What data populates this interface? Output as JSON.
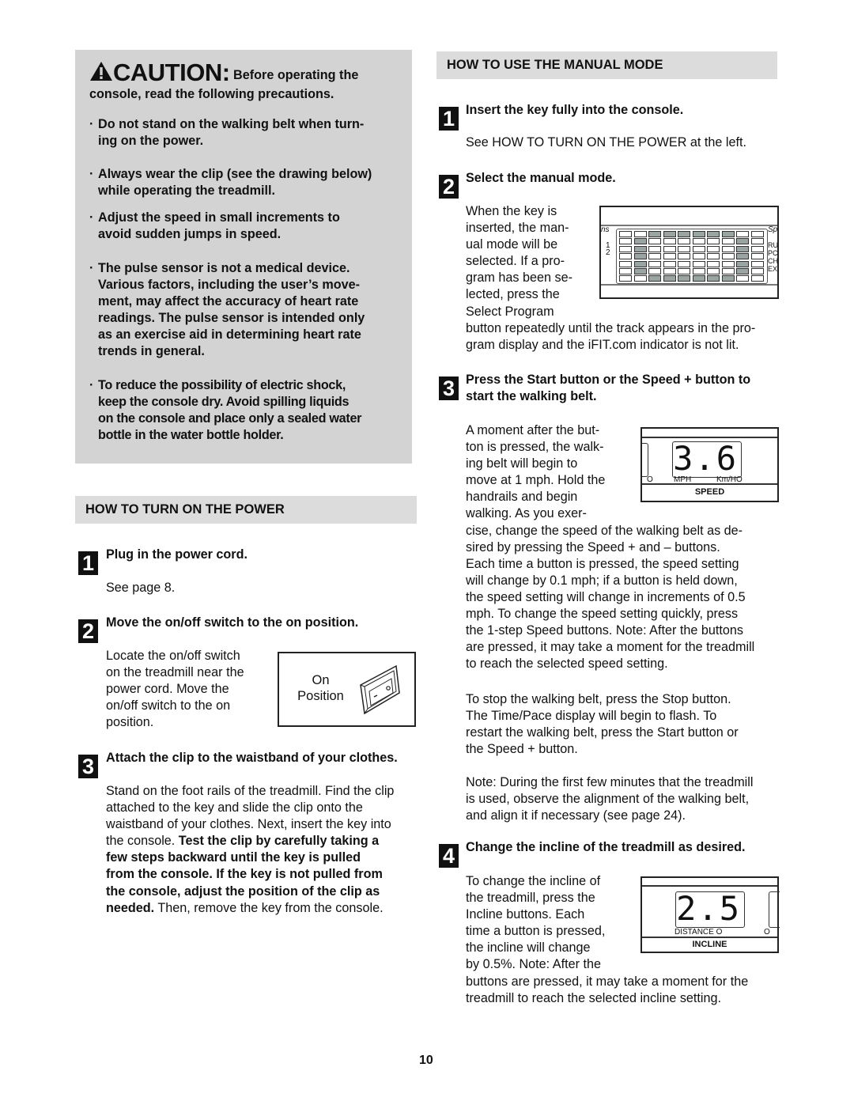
{
  "caution": {
    "icon": "warning-triangle-icon",
    "title": "CAUTION:",
    "subtitle_line1": "Before operating the",
    "subtitle_line2": "console, read the following precautions.",
    "bullets": [
      [
        "Do not stand on the walking belt when turn-",
        "ing on the power."
      ],
      [
        "Always wear the clip (see the drawing below)",
        "while operating the treadmill."
      ],
      [
        "Adjust the speed in small increments to",
        "avoid sudden jumps in speed."
      ],
      [
        "The pulse sensor is not a medical device.",
        "Various factors, including the user’s move-",
        "ment, may affect the accuracy of heart rate",
        "readings. The pulse sensor is intended only",
        "as an exercise aid in determining heart rate",
        "trends in general."
      ],
      [
        "To reduce the possibility of electric shock,",
        "keep the console dry. Avoid spilling liquids",
        "on the console and place only a sealed water",
        "bottle in the water bottle holder."
      ]
    ],
    "bullet_char": "·"
  },
  "power": {
    "header": "HOW TO TURN ON THE POWER",
    "steps": [
      {
        "num": "1",
        "title": "Plug in the power cord.",
        "body": [
          "See page 8."
        ]
      },
      {
        "num": "2",
        "title": "Move the on/off switch to the on position.",
        "body": [
          "Locate the on/off switch",
          "on the treadmill near the",
          "power cord. Move the",
          "on/off switch to the on",
          "position."
        ],
        "figure": {
          "label_line1": "On",
          "label_line2": "Position",
          "icon": "rocker-switch-icon"
        }
      },
      {
        "num": "3",
        "title": "Attach the clip to the waistband of your clothes.",
        "body_plain1": "Stand on the foot rails of the treadmill. Find the clip",
        "body_plain2": "attached to the key and slide the clip onto the",
        "body_plain3": "waistband of your clothes. Next, insert the key into",
        "body_plain4": "the console. ",
        "body_bold4": "Test the clip by carefully taking a",
        "body_bold5": "few steps backward until the key is pulled",
        "body_bold6": "from the console. If the key is not pulled from",
        "body_bold7": "the console, adjust the position of the clip as",
        "body_bold8": "needed.",
        "body_plain8": " Then, remove the key from the console."
      }
    ]
  },
  "manual": {
    "header": "HOW TO USE THE MANUAL MODE",
    "steps": [
      {
        "num": "1",
        "title": "Insert the key fully into the console.",
        "body": [
          "See HOW TO TURN ON THE POWER at the left."
        ]
      },
      {
        "num": "2",
        "title": "Select the manual mode.",
        "body_narrow": [
          "When the key is",
          "inserted, the man-",
          "ual mode will be",
          "selected. If a pro-",
          "gram has been se-",
          "lected, press the",
          "Select Program"
        ],
        "body_wide": [
          "button repeatedly until the track appears in the pro-",
          "gram display and the iFIT.com indicator is not lit."
        ],
        "figure": {
          "left_labels": [
            "ns",
            "1",
            "2"
          ],
          "right_labels": [
            "Sp",
            "RU",
            "PC",
            "CH",
            "EX"
          ]
        }
      },
      {
        "num": "3",
        "title_line1": "Press the Start button or the Speed + button to",
        "title_line2": "start the walking belt.",
        "body_narrow": [
          "A moment after the but-",
          "ton is pressed, the walk-",
          "ing belt will begin to",
          "move at 1 mph. Hold the",
          "handrails and begin",
          "walking. As you exer-"
        ],
        "body_wide": [
          "cise, change the speed of the walking belt as de-",
          "sired by pressing the Speed + and – buttons.",
          "Each time a button is pressed, the speed setting",
          "will change by 0.1 mph; if a button is held down,",
          "the speed setting will change in increments of 0.5",
          "mph. To change the speed setting quickly, press",
          "the 1-step Speed buttons. Note: After the buttons",
          "are pressed, it may take a moment for the treadmill",
          "to reach the selected speed setting."
        ],
        "para2": [
          "To stop the walking belt, press the Stop button.",
          "The Time/Pace display will begin to flash. To",
          "restart the walking belt, press the Start button or",
          "the Speed + button."
        ],
        "para3": [
          "Note: During the first few minutes that the treadmill",
          "is used, observe the alignment of the walking belt,",
          "and align it if necessary (see page 24)."
        ],
        "figure": {
          "value": "3.6",
          "unit_left": "MPH",
          "unit_right": "Km/H",
          "indicator": "O",
          "label": "SPEED"
        }
      },
      {
        "num": "4",
        "title": "Change the incline of the treadmill as desired.",
        "body_narrow": [
          "To change the incline of",
          "the treadmill, press the",
          "Incline buttons. Each",
          "time a button is pressed,",
          "the incline will change",
          "by 0.5%. Note: After the"
        ],
        "body_wide": [
          "buttons are pressed, it may take a moment for the",
          "treadmill to reach the selected incline setting."
        ],
        "figure": {
          "value": "2.5",
          "sub_label": "DISTANCE O",
          "indicator": "O",
          "label": "INCLINE"
        }
      }
    ]
  },
  "page_number": "10"
}
